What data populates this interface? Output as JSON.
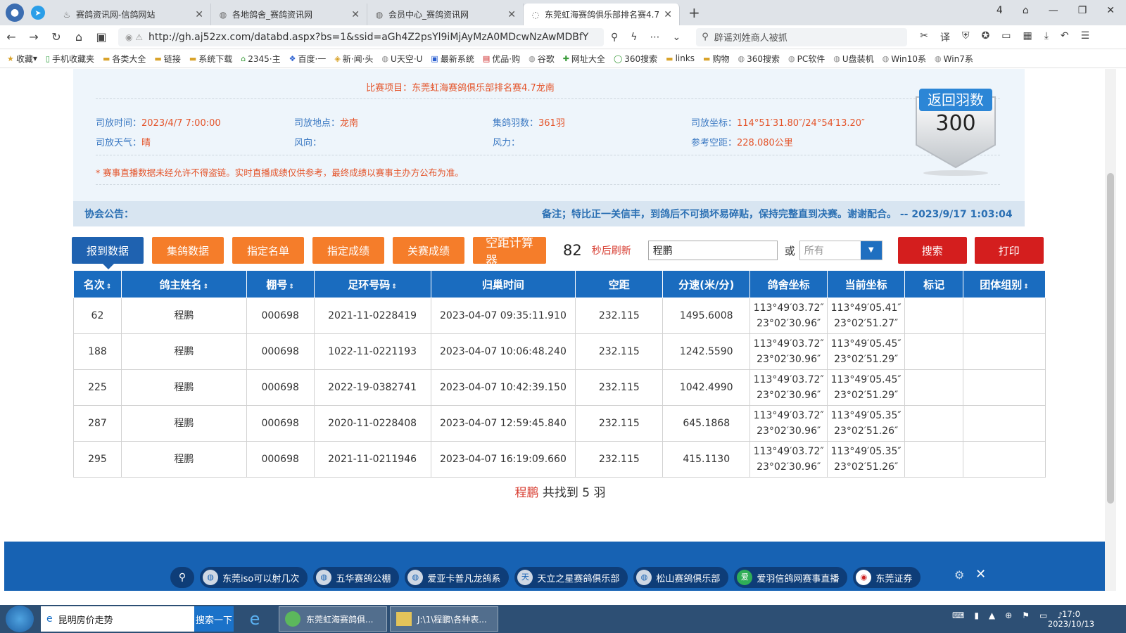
{
  "browser": {
    "tabs": [
      {
        "title": "赛鸽资讯网-信鸽网站",
        "icon": "flame-icon",
        "active": false
      },
      {
        "title": "各地鸽舍_赛鸽资讯网",
        "icon": "globe-icon",
        "active": false
      },
      {
        "title": "会员中心_赛鸽资讯网",
        "icon": "globe-icon",
        "active": false
      },
      {
        "title": "东莞虹海赛鸽俱乐部排名赛4.7",
        "icon": "loading-icon",
        "active": true
      }
    ],
    "url": "http://gh.aj52zx.com/databd.aspx?bs=1&ssid=aGh4Z2psYl9iMjAyMzA0MDcwNzAwMDBfY",
    "search_text": "辟谣刘姓商人被抓",
    "tab_count": "4",
    "bookmarks": [
      "收藏",
      "手机收藏夹",
      "各类大全",
      "链接",
      "系统下载",
      "2345·主",
      "百度·一",
      "新·闻·头",
      "U天空·U",
      "最新系统",
      "优品·购",
      "谷歌",
      "网址大全",
      "360搜索",
      "links",
      "购物",
      "360搜索",
      "PC软件",
      "U盘装机",
      "Win10系",
      "Win7系"
    ]
  },
  "race": {
    "subtitle": "比赛项目：东莞虹海赛鸽俱乐部排名赛4.7龙南",
    "fields": {
      "release_time_label": "司放时间：",
      "release_time": "2023/4/7 7:00:00",
      "release_place_label": "司放地点：",
      "release_place": "龙南",
      "count_label": "集鸽羽数：",
      "count": "361羽",
      "coord_label": "司放坐标：",
      "coord": "114°51′31.80″/24°54′13.20″",
      "weather_label": "司放天气：",
      "weather": "晴",
      "wind_dir_label": "风向：",
      "wind_dir": "",
      "wind_force_label": "风力：",
      "wind_force": "",
      "ref_dist_label": "参考空距：",
      "ref_dist": "228.080公里"
    },
    "notice": "* 赛事直播数据未经允许不得盗链。实时直播成绩仅供参考，最终成绩以赛事主办方公布为准。",
    "badge_title": "返回羽数",
    "badge_count": "300"
  },
  "announcement": {
    "label": "协会公告：",
    "text": "备注；特比正一关信丰，到鸽后不可损坏易碎贴，保持完整直到决赛。谢谢配合。 -- 2023/9/17 1:03:04"
  },
  "controls": {
    "buttons": [
      "报到数据",
      "集鸽数据",
      "指定名单",
      "指定成绩",
      "关赛成绩",
      "空距计算器"
    ],
    "countdown": "82",
    "countdown_label": "秒后刷新",
    "search_value": "程鹏",
    "or_label": "或",
    "select_value": "所有",
    "search_button": "搜索",
    "print_button": "打印"
  },
  "table": {
    "headers": [
      "名次",
      "鸽主姓名",
      "棚号",
      "足环号码",
      "归巢时间",
      "空距",
      "分速(米/分)",
      "鸽舍坐标",
      "当前坐标",
      "标记",
      "团体组别"
    ],
    "rows": [
      {
        "rank": "62",
        "owner": "程鹏",
        "loft": "000698",
        "ring": "2021-11-0228419",
        "time": "2023-04-07 09:35:11.910",
        "dist": "232.115",
        "speed": "1495.6008",
        "home1": "113°49′03.72″",
        "home2": "23°02′30.96″",
        "cur1": "113°49′05.41″",
        "cur2": "23°02′51.27″",
        "mark": "",
        "group": ""
      },
      {
        "rank": "188",
        "owner": "程鹏",
        "loft": "000698",
        "ring": "1022-11-0221193",
        "time": "2023-04-07 10:06:48.240",
        "dist": "232.115",
        "speed": "1242.5590",
        "home1": "113°49′03.72″",
        "home2": "23°02′30.96″",
        "cur1": "113°49′05.45″",
        "cur2": "23°02′51.29″",
        "mark": "",
        "group": ""
      },
      {
        "rank": "225",
        "owner": "程鹏",
        "loft": "000698",
        "ring": "2022-19-0382741",
        "time": "2023-04-07 10:42:39.150",
        "dist": "232.115",
        "speed": "1042.4990",
        "home1": "113°49′03.72″",
        "home2": "23°02′30.96″",
        "cur1": "113°49′05.45″",
        "cur2": "23°02′51.29″",
        "mark": "",
        "group": ""
      },
      {
        "rank": "287",
        "owner": "程鹏",
        "loft": "000698",
        "ring": "2020-11-0228408",
        "time": "2023-04-07 12:59:45.840",
        "dist": "232.115",
        "speed": "645.1868",
        "home1": "113°49′03.72″",
        "home2": "23°02′30.96″",
        "cur1": "113°49′05.35″",
        "cur2": "23°02′51.26″",
        "mark": "",
        "group": ""
      },
      {
        "rank": "295",
        "owner": "程鹏",
        "loft": "000698",
        "ring": "2021-11-0211946",
        "time": "2023-04-07 16:19:09.660",
        "dist": "232.115",
        "speed": "415.1130",
        "home1": "113°49′03.72″",
        "home2": "23°02′30.96″",
        "cur1": "113°49′05.35″",
        "cur2": "23°02′51.26″",
        "mark": "",
        "group": ""
      }
    ]
  },
  "summary": {
    "name": "程鹏",
    "text": " 共找到 5 羽"
  },
  "footer_links": [
    "东莞iso可以射几次",
    "五华赛鸽公棚",
    "爱亚卡普凡龙鸽系",
    "天立之星赛鸽俱乐部",
    "松山赛鸽俱乐部",
    "爱羽信鸽网赛事直播",
    "东莞证券"
  ],
  "taskbar": {
    "search_text": "昆明房价走势",
    "search_button": "搜索一下",
    "tasks": [
      "东莞虹海赛鸽俱...",
      "J:\\1\\程鹏\\各种表..."
    ],
    "clock_time": "17:0",
    "clock_date": "2023/10/13"
  }
}
